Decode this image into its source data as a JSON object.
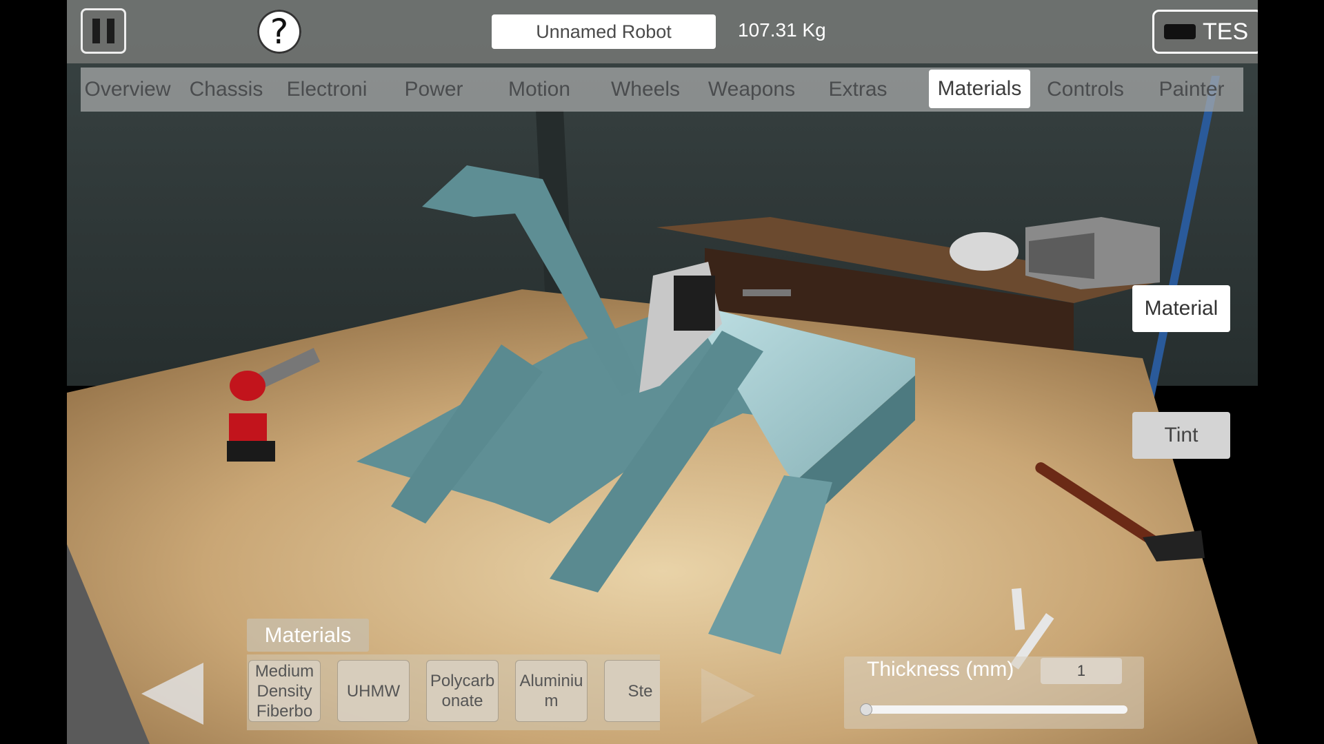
{
  "topbar": {
    "robot_name": "Unnamed Robot",
    "weight": "107.31 Kg",
    "help_label": "?",
    "test_label": "TES"
  },
  "tabs": [
    {
      "label": "Overview"
    },
    {
      "label": "Chassis"
    },
    {
      "label": "Electroni"
    },
    {
      "label": "Power"
    },
    {
      "label": "Motion"
    },
    {
      "label": "Wheels"
    },
    {
      "label": "Weapons"
    },
    {
      "label": "Extras"
    },
    {
      "label": "Materials",
      "active": true
    },
    {
      "label": "Controls"
    },
    {
      "label": "Painter"
    }
  ],
  "side_buttons": {
    "material": "Material",
    "tint": "Tint"
  },
  "materials_panel": {
    "title": "Materials",
    "items": [
      "Medium Density Fiberbo",
      "UHMW",
      "Polycarb onate",
      "Aluminiu m",
      "Ste"
    ]
  },
  "thickness": {
    "label": "Thickness (mm)",
    "value": "1",
    "slider_fraction": 0.0
  },
  "colors": {
    "robot_body": "#5f8f95",
    "table_wood": "#c9a675",
    "wall": "#2f3a3a"
  }
}
